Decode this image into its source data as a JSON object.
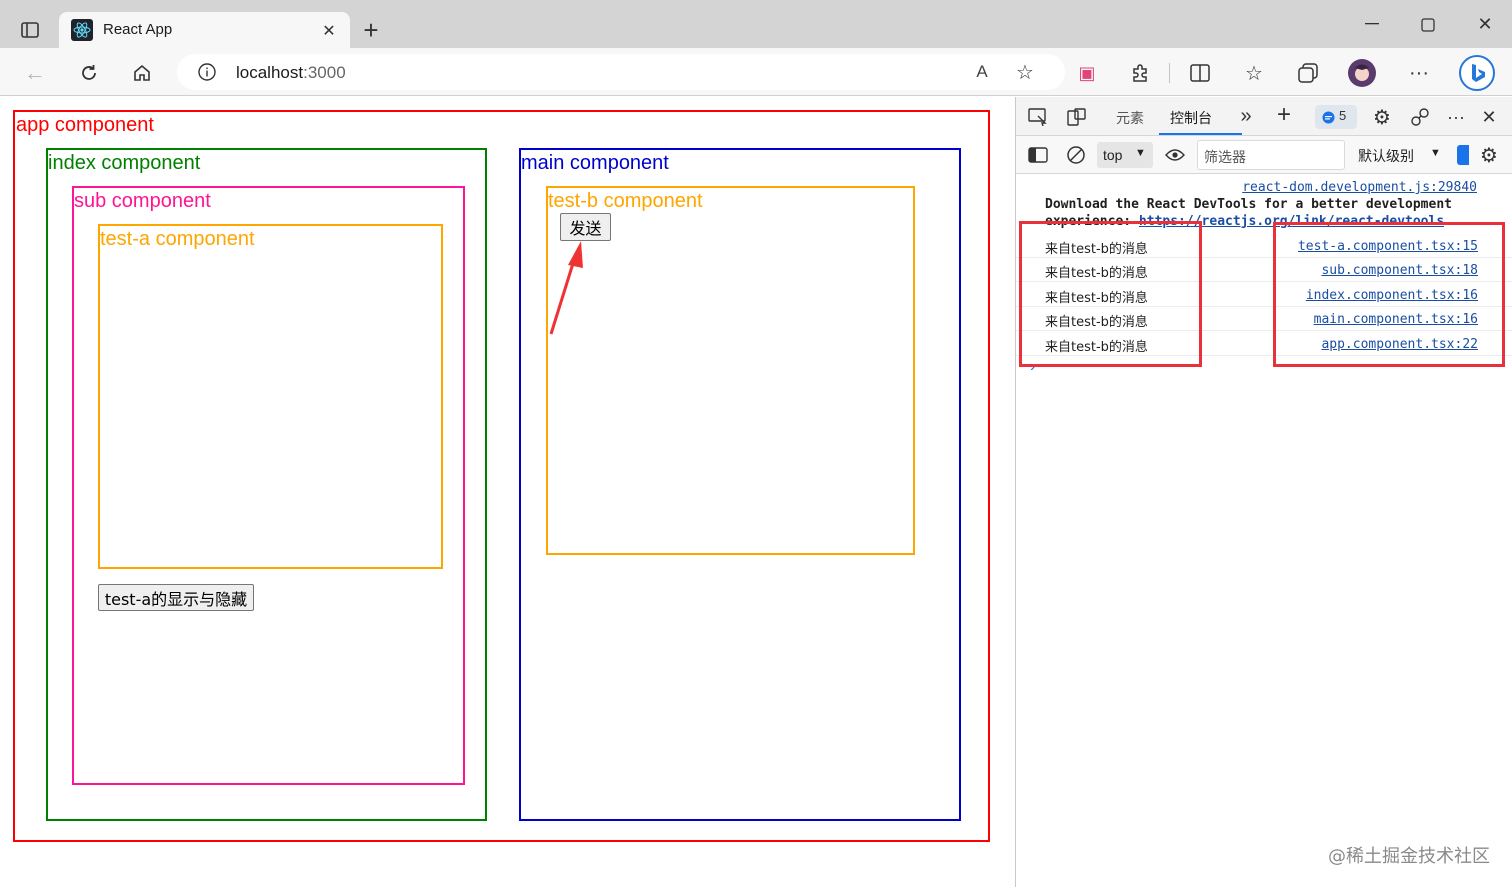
{
  "browser": {
    "tab_title": "React App",
    "url_host": "localhost",
    "url_port": ":3000",
    "icons": [
      "sidebar-icon",
      "react-logo-icon",
      "close-icon",
      "new-tab-icon",
      "minimize-icon",
      "maximize-icon",
      "window-close-icon",
      "back-icon",
      "reload-icon",
      "home-icon",
      "info-icon",
      "read-aloud-icon",
      "favorite-add-icon",
      "extension-icon",
      "puzzle-icon",
      "split-screen-icon",
      "favorites-icon",
      "collections-icon",
      "profile-avatar-icon",
      "more-icon",
      "bing-icon"
    ],
    "read_aloud_label": "A"
  },
  "page": {
    "app": {
      "label": "app component",
      "color": "#ff0000"
    },
    "index": {
      "label": "index component",
      "color": "#008000"
    },
    "sub": {
      "label": "sub component",
      "color": "#ff1493"
    },
    "test_a": {
      "label": "test-a component",
      "color": "#ffa500"
    },
    "toggle_button": "test-a的显示与隐藏",
    "main": {
      "label": "main component",
      "color": "#0000cd"
    },
    "test_b": {
      "label": "test-b component",
      "color": "#ffa500"
    },
    "send_button": "发送"
  },
  "devtools": {
    "tabs": {
      "elements": "元素",
      "console": "控制台",
      "issues_count": "5"
    },
    "console_bar": {
      "context": "top",
      "filter_placeholder": "筛选器",
      "level": "默认级别"
    },
    "first_source": "react-dom.development.js:29840",
    "devtools_line1": "Download the React DevTools for a better development",
    "devtools_line2_prefix": "experience: ",
    "devtools_link": "https://reactjs.org/link/react-devtools",
    "logs": [
      {
        "message": "来自test-b的消息",
        "source": "test-a.component.tsx:15"
      },
      {
        "message": "来自test-b的消息",
        "source": "sub.component.tsx:18"
      },
      {
        "message": "来自test-b的消息",
        "source": "index.component.tsx:16"
      },
      {
        "message": "来自test-b的消息",
        "source": "main.component.tsx:16"
      },
      {
        "message": "来自test-b的消息",
        "source": "app.component.tsx:22"
      }
    ],
    "prompt": "›"
  },
  "watermark": "@稀土掘金技术社区"
}
